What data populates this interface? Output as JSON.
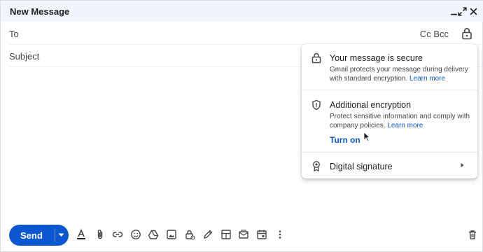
{
  "compose": {
    "title": "New Message",
    "to_label": "To",
    "subject_placeholder": "Subject",
    "cc_bcc": "Cc Bcc"
  },
  "panel": {
    "secure": {
      "title": "Your message is secure",
      "desc": "Gmail protects your message during delivery with standard encryption.",
      "link": "Learn more"
    },
    "additional": {
      "title": "Additional encryption",
      "desc": "Protect sensitive information and comply with company policies.",
      "link": "Learn more",
      "action": "Turn on"
    },
    "signature": {
      "title": "Digital signature"
    }
  },
  "toolbar": {
    "send_label": "Send",
    "icons": [
      "format-text-icon",
      "attach-icon",
      "link-icon",
      "emoji-icon",
      "drive-icon",
      "photo-icon",
      "confidential-icon",
      "signature-icon",
      "layout-icon",
      "email-template-icon",
      "schedule-icon",
      "more-icon",
      "delete-icon"
    ]
  },
  "colors": {
    "accent": "#0b57d0",
    "titlebar": "#f2f6fc"
  }
}
